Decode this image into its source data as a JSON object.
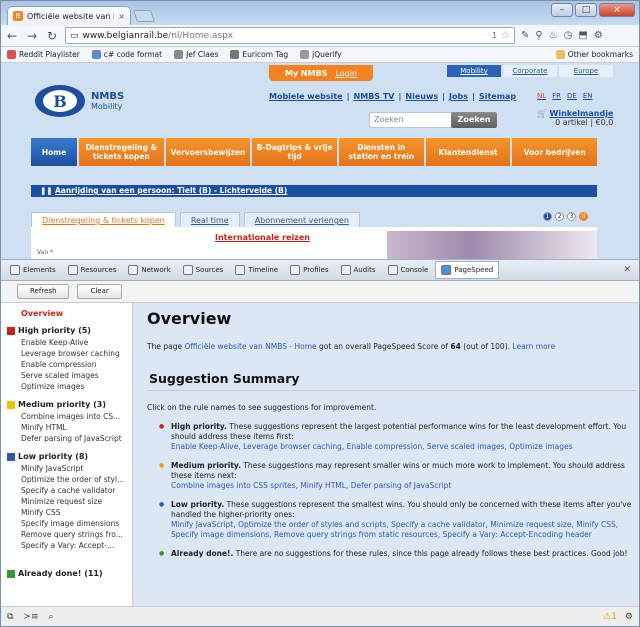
{
  "browser": {
    "tab_title": "Officiële website van NMBS",
    "tab_close": "×",
    "window_buttons": [
      "–",
      "□",
      "×"
    ],
    "url_host": "www.belgianrail.be",
    "url_path": "/nl/Home.aspx",
    "omnibox_badge": "1",
    "bookmarks": [
      {
        "label": "Reddit Playlister",
        "color": "#d9534f"
      },
      {
        "label": "c# code format",
        "color": "#5b8ad6"
      },
      {
        "label": "Jef Claes",
        "color": "#888888"
      },
      {
        "label": "Euricom Tag",
        "color": "#777777"
      },
      {
        "label": "jQuerify",
        "color": "#999999"
      }
    ],
    "other_bookmarks": "Other bookmarks"
  },
  "site": {
    "my_nmbs": "My NMBS",
    "login": "Login",
    "top_tabs": [
      "Mobility",
      "Corporate",
      "Europe"
    ],
    "brand": "NMBS",
    "brand_sub": "Mobility",
    "logo_letter": "B",
    "top_links": [
      "Mobiele website",
      "NMBS TV",
      "Nieuws",
      "Jobs",
      "Sitemap"
    ],
    "langs": [
      "NL",
      "FR",
      "DE",
      "EN"
    ],
    "search_placeholder": "Zoeken",
    "search_button": "Zoeken",
    "cart_title": "Winkelmandje",
    "cart_detail": "0 artikel | €0,0",
    "menu": [
      "Home",
      "Dienstregeling & tickets kopen",
      "Vervoersbewijzen",
      "B-Dagtrips & vrije tijd",
      "Diensten in station en trein",
      "Klantendienst",
      "Voor bedrijven"
    ],
    "ticker": "Aanrijding van een persoon: Tielt (B) - Lichtervelde (B)",
    "sub_tabs": [
      "Dienstregeling & tickets kopen",
      "Real time",
      "Abonnement verlengen"
    ],
    "pager": [
      "1",
      "2",
      "3",
      "II"
    ],
    "intl_link": "Internationale reizen",
    "from_label": "Van  *"
  },
  "devtools": {
    "tabs": [
      "Elements",
      "Resources",
      "Network",
      "Sources",
      "Timeline",
      "Profiles",
      "Audits",
      "Console",
      "PageSpeed"
    ],
    "refresh": "Refresh",
    "clear": "Clear",
    "sidebar": {
      "overview": "Overview",
      "groups": [
        {
          "label": "High priority (5)",
          "color": "#c8231a",
          "items": [
            "Enable Keep-Alive",
            "Leverage browser caching",
            "Enable compression",
            "Serve scaled images",
            "Optimize images"
          ]
        },
        {
          "label": "Medium priority (3)",
          "color": "#e8c400",
          "items": [
            "Combine images into CS...",
            "Minify HTML",
            "Defer parsing of JavaScript"
          ]
        },
        {
          "label": "Low priority (8)",
          "color": "#2b5ab4",
          "items": [
            "Minify JavaScript",
            "Optimize the order of styl...",
            "Specify a cache validator",
            "Minimize request size",
            "Minify CSS",
            "Specify image dimensions",
            "Remove query strings fro...",
            "Specify a Vary: Accept-..."
          ]
        },
        {
          "label": "Already done! (11)",
          "color": "#2c9a2c",
          "items": []
        }
      ]
    },
    "main": {
      "title": "Overview",
      "score_prefix": "The page",
      "score_link": "Officiële website van NMBS - Home",
      "score_mid": "got an overall PageSpeed Score of",
      "score_value": "64",
      "score_suffix": "(out of 100).",
      "learn_more": "Learn more",
      "summary_title": "Suggestion Summary",
      "intro": "Click on the rule names to see suggestions for improvement.",
      "high_label": "High priority.",
      "high_text": "These suggestions represent the largest potential performance wins for the least development effort. You should address these items first:",
      "high_links": "Enable Keep-Alive, Leverage browser caching, Enable compression, Serve scaled images, Optimize images",
      "med_label": "Medium priority.",
      "med_text": "These suggestions may represent smaller wins or much more work to implement. You should address these items next:",
      "med_links": "Combine images into CSS sprites, Minify HTML, Defer parsing of JavaScript",
      "low_label": "Low priority.",
      "low_text": "These suggestions represent the smallest wins. You should only be concerned with these items after you've handled the higher-priority ones:",
      "low_links": "Minify JavaScript, Optimize the order of styles and scripts, Specify a cache validator, Minimize request size, Minify CSS, Specify image dimensions, Remove query strings from static resources, Specify a Vary: Accept-Encoding header",
      "done_label": "Already done!.",
      "done_text": "There are no suggestions for these rules, since this page already follows these best practices. Good job!"
    },
    "status_warn": "1"
  }
}
